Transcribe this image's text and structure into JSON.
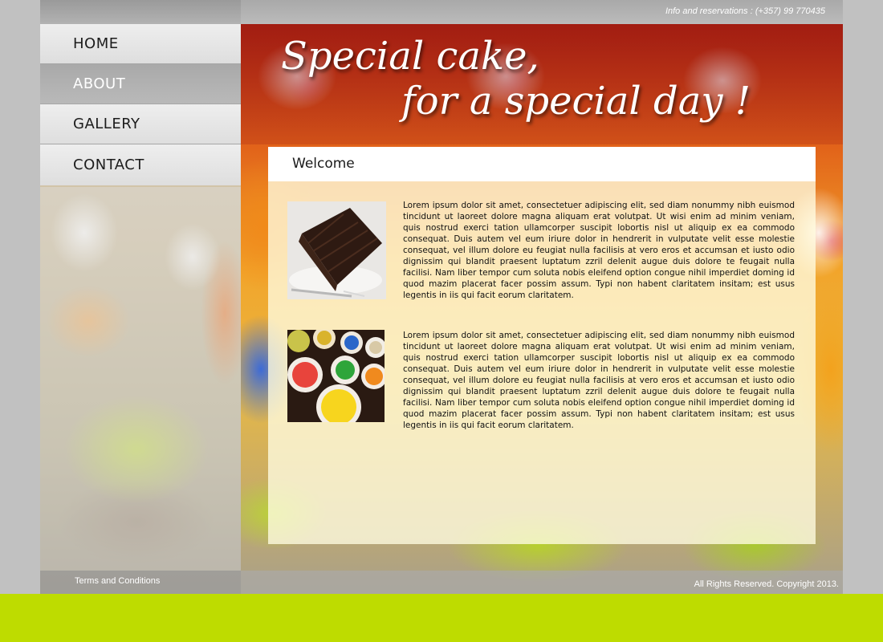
{
  "header": {
    "reservations_text": "Info and reservations : (+357) 99 770435",
    "tagline_line1": "Special cake,",
    "tagline_line2": "for a special day !"
  },
  "nav": {
    "items": [
      {
        "label": "HOME",
        "active": false
      },
      {
        "label": "ABOUT",
        "active": true
      },
      {
        "label": "GALLERY",
        "active": false
      },
      {
        "label": "CONTACT",
        "active": false
      }
    ]
  },
  "main": {
    "title": "Welcome",
    "articles": [
      {
        "image": "chocolate-cake-slice-photo",
        "text": "Lorem ipsum dolor sit amet, consectetuer adipiscing elit, sed diam nonummy nibh euismod tincidunt ut laoreet dolore magna aliquam erat volutpat. Ut wisi enim ad minim veniam, quis nostrud exerci tation ullamcorper suscipit lobortis nisl ut aliquip ex ea commodo consequat. Duis autem vel eum iriure dolor in hendrerit in vulputate velit esse molestie consequat, vel illum dolore eu feugiat nulla facilisis at vero eros et accumsan et iusto odio dignissim qui blandit praesent luptatum zzril delenit augue duis dolore te feugait nulla facilisi. Nam liber tempor cum soluta nobis eleifend option congue nihil imperdiet doming id quod mazim placerat facer possim assum. Typi non habent claritatem insitam; est usus legentis in iis qui facit eorum claritatem."
      },
      {
        "image": "colored-icing-bowls-photo",
        "text": "Lorem ipsum dolor sit amet, consectetuer adipiscing elit, sed diam nonummy nibh euismod tincidunt ut laoreet dolore magna aliquam erat volutpat. Ut wisi enim ad minim veniam, quis nostrud exerci tation ullamcorper suscipit lobortis nisl ut aliquip ex ea commodo consequat. Duis autem vel eum iriure dolor in hendrerit in vulputate velit esse molestie consequat, vel illum dolore eu feugiat nulla facilisis at vero eros et accumsan et iusto odio dignissim qui blandit praesent luptatum zzril delenit augue duis dolore te feugait nulla facilisi. Nam liber tempor cum soluta nobis eleifend option congue nihil imperdiet doming id quod mazim placerat facer possim assum. Typi non habent claritatem insitam; est usus legentis in iis qui facit eorum claritatem."
      }
    ]
  },
  "footer": {
    "terms_label": "Terms and Conditions",
    "copyright": "All Rights Reserved. Copyright 2013."
  },
  "colors": {
    "accent_green": "#bedc00",
    "nav_active": "#b1b1b1",
    "page_gray": "#c1c1c1"
  }
}
